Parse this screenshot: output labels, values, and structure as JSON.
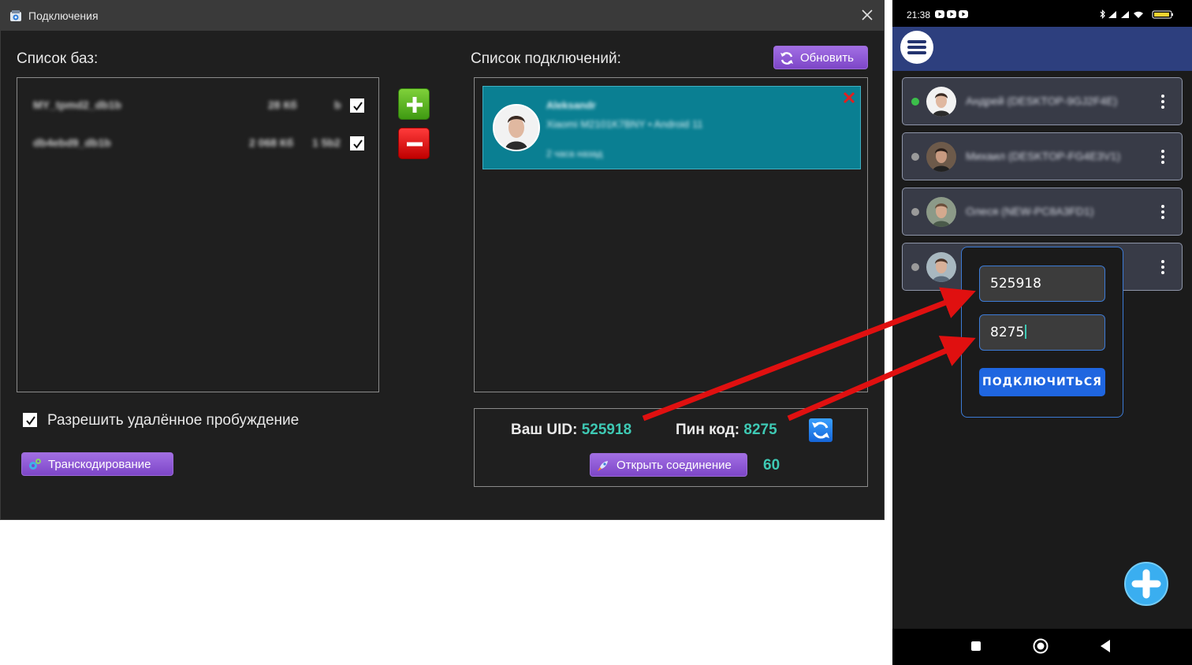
{
  "window": {
    "title": "Подключения"
  },
  "databases": {
    "label": "Список баз:",
    "items": [
      {
        "name": "MY_tpmd2_db1b",
        "size": "28 Кб",
        "extra": "b",
        "checked": true
      },
      {
        "name": "db4ebd9_db1b",
        "size": "2 068 Кб",
        "extra": "1 5b2",
        "checked": true
      }
    ]
  },
  "connections": {
    "label": "Список подключений:",
    "refresh_label": "Обновить",
    "card": {
      "name": "Aleksandr",
      "device": "Xiaomi M2101K7BNY • Android 11",
      "time": "2 часа назад"
    }
  },
  "wake": {
    "label": "Разрешить удалённое пробуждение",
    "checked": true
  },
  "transcode_label": "Транскодирование",
  "uid": {
    "uid_label": "Ваш UID:",
    "uid_value": "525918",
    "pin_label": "Пин код:",
    "pin_value": "8275",
    "open_label": "Открыть соединение",
    "timer": "60"
  },
  "phone": {
    "status_time": "21:38",
    "items": [
      {
        "name": "Андрей (DESKTOP-9GJ2F4E)",
        "online": true
      },
      {
        "name": "Михаил (DESKTOP-FG4E3V1)",
        "online": false
      },
      {
        "name": "Олеся (NEW-PC8A3FD1)",
        "online": false
      },
      {
        "name": "",
        "online": false
      }
    ],
    "popup": {
      "uid_value": "525918",
      "pin_value": "8275",
      "connect_label": "ПОДКЛЮЧИТЬСЯ"
    }
  },
  "colors": {
    "accent_teal": "#3ec9b4",
    "card_teal": "#0a7f92",
    "purple": "#8a55d3",
    "phone_blue": "#2d3f7e",
    "arrow_red": "#e01010"
  }
}
